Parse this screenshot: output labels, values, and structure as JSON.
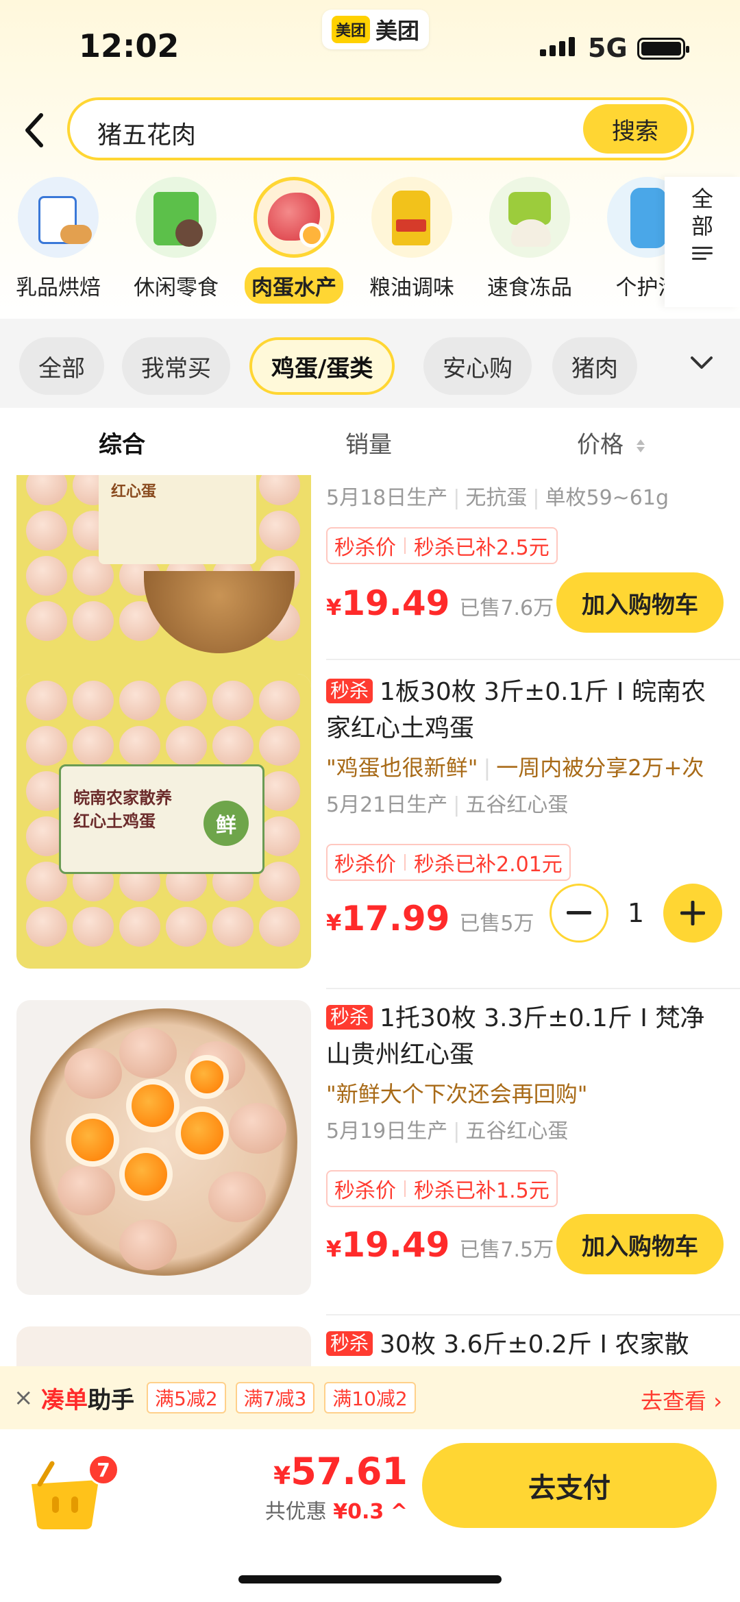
{
  "status_bar": {
    "time": "12:02",
    "app_logo": "美团",
    "app_name": "美团",
    "network": "5G"
  },
  "search": {
    "query": "猪五花肉",
    "button": "搜索"
  },
  "categories": [
    {
      "label": "乳品烘焙",
      "icon": "milk-icon",
      "active": false
    },
    {
      "label": "休闲零食",
      "icon": "snack-icon",
      "active": false
    },
    {
      "label": "肉蛋水产",
      "icon": "meat-icon",
      "active": true
    },
    {
      "label": "粮油调味",
      "icon": "oil-icon",
      "active": false
    },
    {
      "label": "速食冻品",
      "icon": "instant-food-icon",
      "active": false
    },
    {
      "label": "个护清",
      "icon": "detergent-icon",
      "active": false
    }
  ],
  "all_categories": {
    "line1": "全",
    "line2": "部"
  },
  "filter_chips": [
    {
      "label": "全部",
      "active": false
    },
    {
      "label": "我常买",
      "active": false
    },
    {
      "label": "鸡蛋/蛋类",
      "active": true
    },
    {
      "label": "安心购",
      "active": false
    },
    {
      "label": "猪肉",
      "active": false
    }
  ],
  "sort_tabs": [
    {
      "label": "综合",
      "active": true
    },
    {
      "label": "销量",
      "active": false
    },
    {
      "label": "价格",
      "active": false
    }
  ],
  "products": [
    {
      "flash_tag": "",
      "title": "",
      "review": "",
      "meta": [
        "5月18日生产",
        "无抗蛋",
        "单枚59~61g"
      ],
      "promo_label": "秒杀价",
      "promo_subsidy": "秒杀已补2.5元",
      "currency": "¥",
      "price": "19.49",
      "sold": "已售7.6万",
      "action": "加入购物车",
      "image_text": "红心蛋"
    },
    {
      "flash_tag": "秒杀",
      "title": "1板30枚 3斤±0.1斤 I 皖南农家红心土鸡蛋",
      "review": "\"鸡蛋也很新鲜\"",
      "review_extra": "一周内被分享2万+次",
      "meta": [
        "5月21日生产",
        "五谷红心蛋"
      ],
      "promo_label": "秒杀价",
      "promo_subsidy": "秒杀已补2.01元",
      "currency": "¥",
      "price": "17.99",
      "sold": "已售5万",
      "quantity": "1",
      "image_text_1": "皖南农家散养",
      "image_text_2": "红心土鸡蛋",
      "image_badge": "鲜"
    },
    {
      "flash_tag": "秒杀",
      "title": "1托30枚 3.3斤±0.1斤 I 梵净山贵州红心蛋",
      "review": "\"新鲜大个下次还会再回购\"",
      "meta": [
        "5月19日生产",
        "五谷红心蛋"
      ],
      "promo_label": "秒杀价",
      "promo_subsidy": "秒杀已补1.5元",
      "currency": "¥",
      "price": "19.49",
      "sold": "已售7.5万",
      "action": "加入购物车"
    },
    {
      "flash_tag": "秒杀",
      "title": "30枚 3.6斤±0.2斤 I 农家散"
    }
  ],
  "helper_bar": {
    "brand_red": "凑单",
    "brand_dark": "助手",
    "coupons": [
      "满5减2",
      "满7减3",
      "满10减2"
    ],
    "link": "去查看"
  },
  "checkout": {
    "cart_count": "7",
    "currency": "¥",
    "total": "57.61",
    "discount_label": "共优惠",
    "discount": "¥0.3",
    "pay_button": "去支付"
  },
  "colors": {
    "accent": "#ffd633",
    "price": "#ff2a2a",
    "flash_tag": "#ff3b30"
  }
}
